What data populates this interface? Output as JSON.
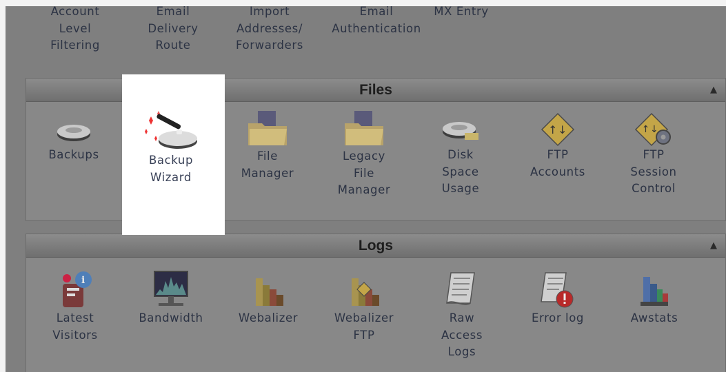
{
  "email_row": {
    "items": [
      {
        "label": "Account\nLevel\nFiltering"
      },
      {
        "label": "Email\nDelivery\nRoute"
      },
      {
        "label": "Import\nAddresses/\nForwarders"
      },
      {
        "label": "Email\nAuthentication"
      },
      {
        "label": "MX Entry"
      }
    ]
  },
  "files": {
    "title": "Files",
    "collapse_icon": "triangle-up-icon",
    "items": [
      {
        "label": "Backups",
        "icon": "hard-drive-icon"
      },
      {
        "label": "Backup\nWizard",
        "icon": "magic-wand-icon"
      },
      {
        "label": "File\nManager",
        "icon": "folder-icon"
      },
      {
        "label": "Legacy\nFile\nManager",
        "icon": "folder-icon"
      },
      {
        "label": "Disk\nSpace\nUsage",
        "icon": "disk-usage-icon"
      },
      {
        "label": "FTP\nAccounts",
        "icon": "ftp-icon"
      },
      {
        "label": "FTP\nSession\nControl",
        "icon": "ftp-gear-icon"
      }
    ]
  },
  "logs": {
    "title": "Logs",
    "collapse_icon": "triangle-up-icon",
    "items": [
      {
        "label": "Latest\nVisitors",
        "icon": "visitors-icon"
      },
      {
        "label": "Bandwidth",
        "icon": "bandwidth-icon"
      },
      {
        "label": "Webalizer",
        "icon": "bar-chart-icon"
      },
      {
        "label": "Webalizer\nFTP",
        "icon": "bar-chart-ftp-icon"
      },
      {
        "label": "Raw\nAccess\nLogs",
        "icon": "log-file-icon"
      },
      {
        "label": "Error log",
        "icon": "error-log-icon"
      },
      {
        "label": "Awstats",
        "icon": "awstats-icon"
      }
    ]
  },
  "highlight": {
    "target": "Backup Wizard",
    "color": "#ffffff"
  }
}
